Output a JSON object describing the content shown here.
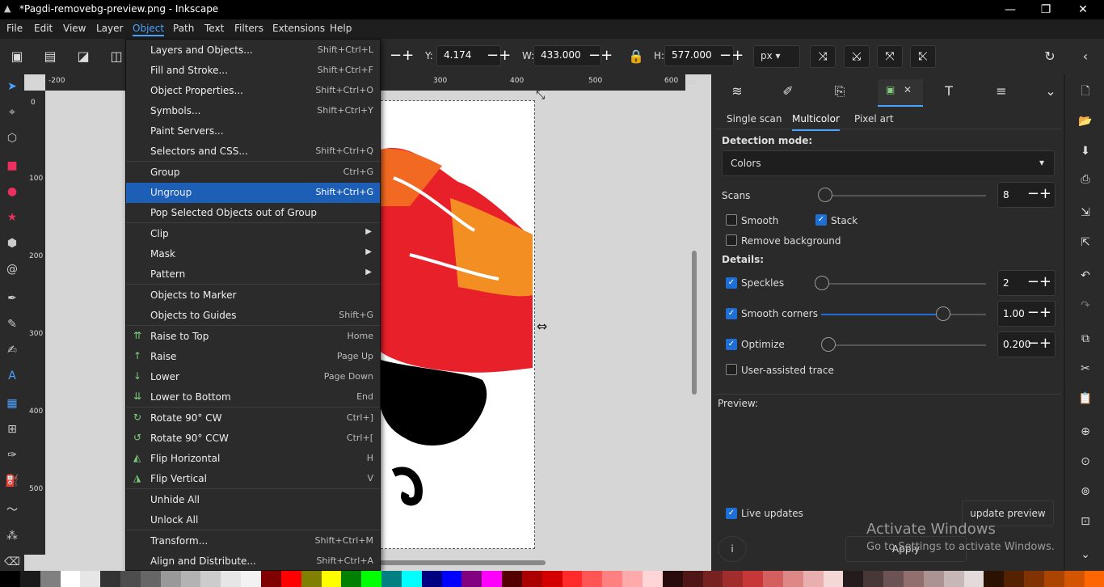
{
  "window": {
    "title": "*Pagdi-removebg-preview.png - Inkscape",
    "min": "—",
    "max": "❐",
    "close": "✕"
  },
  "menubar": [
    "File",
    "Edit",
    "View",
    "Layer",
    "Object",
    "Path",
    "Text",
    "Filters",
    "Extensions",
    "Help"
  ],
  "toolbar": {
    "y_label": "Y:",
    "y_value": "4.174",
    "w_label": "W:",
    "w_value": "433.000",
    "h_label": "H:",
    "h_value": "577.000",
    "unit": "px"
  },
  "ruler": {
    "h": [
      "-200",
      "300",
      "400",
      "500",
      "600"
    ],
    "v": [
      "0",
      "100",
      "200",
      "300",
      "400",
      "500"
    ]
  },
  "menu": [
    {
      "label": "Layers and Objects...",
      "shortcut": "Shift+Ctrl+L"
    },
    {
      "label": "Fill and Stroke...",
      "shortcut": "Shift+Ctrl+F"
    },
    {
      "label": "Object Properties...",
      "shortcut": "Shift+Ctrl+O"
    },
    {
      "label": "Symbols...",
      "shortcut": "Shift+Ctrl+Y"
    },
    {
      "label": "Paint Servers...",
      "shortcut": ""
    },
    {
      "label": "Selectors and CSS...",
      "shortcut": "Shift+Ctrl+Q"
    },
    {
      "label": "Group",
      "shortcut": "Ctrl+G"
    },
    {
      "label": "Ungroup",
      "shortcut": "Shift+Ctrl+G"
    },
    {
      "label": "Pop Selected Objects out of Group",
      "shortcut": ""
    },
    {
      "label": "Clip",
      "shortcut": ""
    },
    {
      "label": "Mask",
      "shortcut": ""
    },
    {
      "label": "Pattern",
      "shortcut": ""
    },
    {
      "label": "Objects to Marker",
      "shortcut": ""
    },
    {
      "label": "Objects to Guides",
      "shortcut": "Shift+G"
    },
    {
      "label": "Raise to Top",
      "shortcut": "Home"
    },
    {
      "label": "Raise",
      "shortcut": "Page Up"
    },
    {
      "label": "Lower",
      "shortcut": "Page Down"
    },
    {
      "label": "Lower to Bottom",
      "shortcut": "End"
    },
    {
      "label": "Rotate 90° CW",
      "shortcut": "Ctrl+]"
    },
    {
      "label": "Rotate 90° CCW",
      "shortcut": "Ctrl+["
    },
    {
      "label": "Flip Horizontal",
      "shortcut": "H"
    },
    {
      "label": "Flip Vertical",
      "shortcut": "V"
    },
    {
      "label": "Unhide All",
      "shortcut": ""
    },
    {
      "label": "Unlock All",
      "shortcut": ""
    },
    {
      "label": "Transform...",
      "shortcut": "Shift+Ctrl+M"
    },
    {
      "label": "Align and Distribute...",
      "shortcut": "Shift+Ctrl+A"
    }
  ],
  "trace": {
    "tabs": [
      "Single scan",
      "Multicolor",
      "Pixel art"
    ],
    "detection_label": "Detection mode:",
    "detection_value": "Colors",
    "scans_label": "Scans",
    "scans_value": "8",
    "smooth": "Smooth",
    "stack": "Stack",
    "remove_bg": "Remove background",
    "details": "Details:",
    "speckles": "Speckles",
    "speckles_value": "2",
    "smooth_corners": "Smooth corners",
    "smooth_corners_value": "1.00",
    "optimize": "Optimize",
    "optimize_value": "0.200",
    "user_assisted": "User-assisted trace",
    "preview": "Preview:",
    "live_updates": "Live updates",
    "update_preview": "update preview",
    "apply": "Apply",
    "info": "i"
  },
  "watermark": {
    "line1": "Activate Windows",
    "line2": "Go to Settings to activate Windows."
  },
  "palette": [
    "#000000",
    "#1a1a1a",
    "#808080",
    "#ffffff",
    "#e6e6e6",
    "#333333",
    "#4d4d4d",
    "#666666",
    "#999999",
    "#b3b3b3",
    "#cccccc",
    "#e6e6e6",
    "#f2f2f2",
    "#800000",
    "#ff0000",
    "#808000",
    "#ffff00",
    "#008000",
    "#00ff00",
    "#008080",
    "#00ffff",
    "#000080",
    "#0000ff",
    "#800080",
    "#ff00ff",
    "#550000",
    "#aa0000",
    "#d40000",
    "#ff2a2a",
    "#ff5555",
    "#ff8080",
    "#ffaaaa",
    "#ffd5d5",
    "#280b0b",
    "#501616",
    "#782121",
    "#a02c2c",
    "#c83737",
    "#d35f5f",
    "#de8787",
    "#e9afaf",
    "#f4d7d7",
    "#241c1c",
    "#483737",
    "#6c5353",
    "#916f6f",
    "#ac9393",
    "#c8b7b7",
    "#e3dbdb",
    "#2b1100",
    "#552200",
    "#803300",
    "#aa4400",
    "#d45500",
    "#ff6600"
  ]
}
